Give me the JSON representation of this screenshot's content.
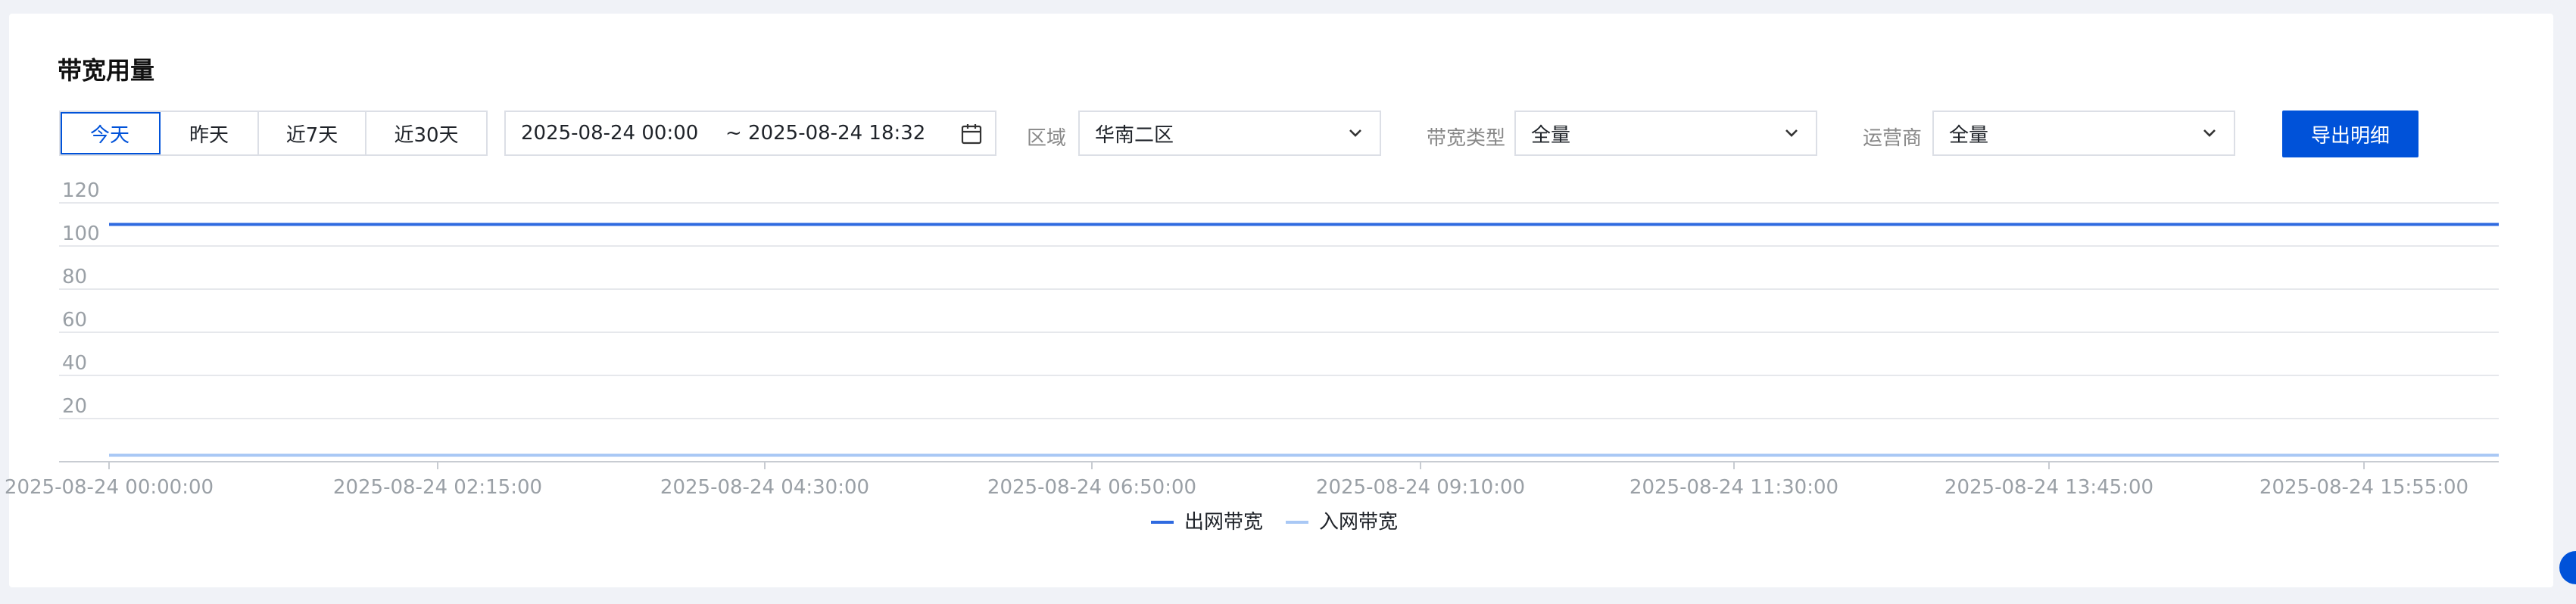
{
  "page": {
    "title": "带宽用量"
  },
  "toolbar": {
    "ranges": [
      {
        "label": "今天",
        "active": true
      },
      {
        "label": "昨天",
        "active": false
      },
      {
        "label": "近7天",
        "active": false
      },
      {
        "label": "近30天",
        "active": false
      }
    ],
    "date_start": "2025-08-24 00:00",
    "date_end": "~ 2025-08-24 18:32",
    "region_label": "区域",
    "region_value": "华南二区",
    "bandwidth_type_label": "带宽类型",
    "bandwidth_type_value": "全量",
    "carrier_label": "运营商",
    "carrier_value": "全量",
    "export_label": "导出明细"
  },
  "colors": {
    "accent": "#0052d9",
    "outbound": "#2f6ae0",
    "inbound": "#a9c8f5"
  },
  "chart_data": {
    "type": "line",
    "x": [
      "2025-08-24 00:00:00",
      "2025-08-24 02:15:00",
      "2025-08-24 04:30:00",
      "2025-08-24 06:50:00",
      "2025-08-24 09:10:00",
      "2025-08-24 11:30:00",
      "2025-08-24 13:45:00",
      "2025-08-24 15:55:00"
    ],
    "y_ticks": [
      20,
      40,
      60,
      80,
      100,
      120
    ],
    "ylim": [
      0,
      120
    ],
    "series": [
      {
        "name": "出网带宽",
        "values": [
          110,
          110,
          110,
          110,
          110,
          110,
          110,
          110
        ],
        "color": "#2f6ae0"
      },
      {
        "name": "入网带宽",
        "values": [
          3,
          3,
          3,
          3,
          3,
          3,
          3,
          3
        ],
        "color": "#a9c8f5"
      }
    ],
    "grid": true,
    "legend": "bottom-center"
  }
}
